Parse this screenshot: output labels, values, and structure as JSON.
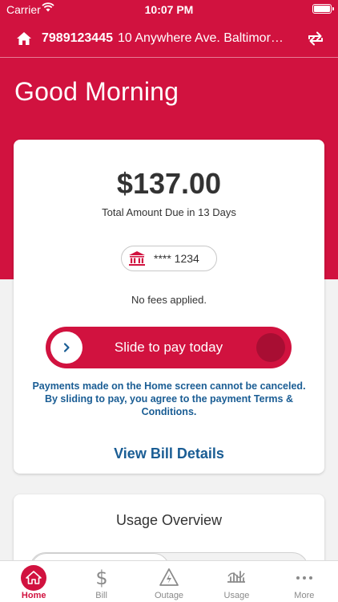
{
  "status": {
    "carrier": "Carrier",
    "time": "10:07 PM"
  },
  "account": {
    "number": "7989123445",
    "address": "10 Anywhere Ave. Baltimore,..."
  },
  "greeting": "Good Morning",
  "bill": {
    "amount": "$137.00",
    "due_text": "Total Amount Due in 13 Days",
    "bank_masked": "**** 1234",
    "fees_text": "No fees applied.",
    "slide_label": "Slide to pay today",
    "disclaimer": "Payments made on the Home screen cannot be canceled. By sliding to pay, you agree to the payment Terms & Conditions.",
    "view_details": "View Bill Details"
  },
  "usage": {
    "title": "Usage Overview"
  },
  "tabs": [
    {
      "label": "Home",
      "icon": "home-icon",
      "active": true
    },
    {
      "label": "Bill",
      "icon": "dollar-icon",
      "active": false
    },
    {
      "label": "Outage",
      "icon": "outage-warning-icon",
      "active": false
    },
    {
      "label": "Usage",
      "icon": "usage-meter-icon",
      "active": false
    },
    {
      "label": "More",
      "icon": "more-dots-icon",
      "active": false
    }
  ],
  "colors": {
    "brand": "#d1123f",
    "link": "#1a5d94"
  }
}
